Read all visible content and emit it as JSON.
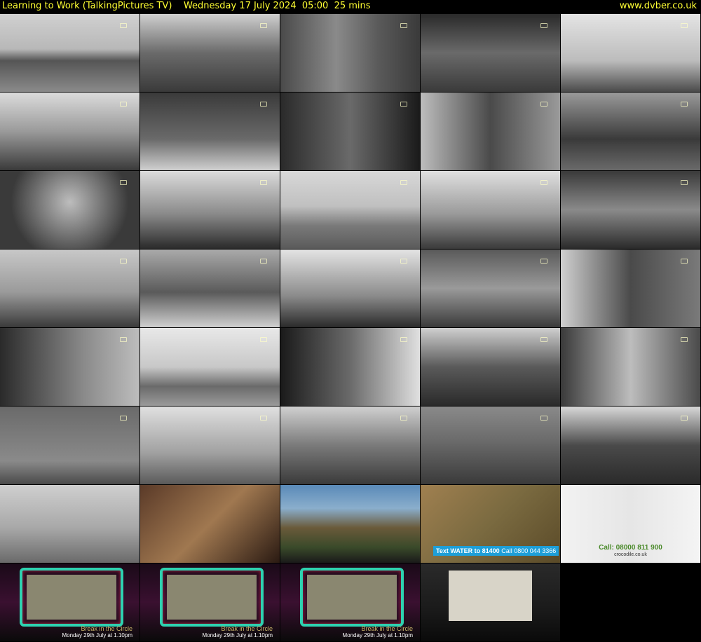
{
  "header": {
    "programme": "Learning to Work (TalkingPictures TV)",
    "datetime": "Wednesday 17 July 2024  05:00  25 mins",
    "website": "www.dvber.co.uk"
  },
  "colors": {
    "header_text": "#ffff33",
    "background": "#000000",
    "text_strip": "#1e9fd8",
    "crocodile_green": "#4a8a2a",
    "cinema_frame": "#2ed1b0"
  },
  "thumbnails": [
    {
      "id": 1,
      "scene": "thames-parliament",
      "bg": "linear-gradient(#d0d0d0 0%, #b8b8b8 45%, #555 60%, #8a8a8a 100%)"
    },
    {
      "id": 2,
      "scene": "city-street",
      "bg": "linear-gradient(#cfcfcf 0%, #6a6a6a 50%, #3a3a3a 100%)"
    },
    {
      "id": 3,
      "scene": "bank-entrance",
      "bg": "linear-gradient(90deg,#4a4a4a,#8a8a8a 40%,#5a5a5a 70%,#3a3a3a)"
    },
    {
      "id": 4,
      "scene": "uk-map",
      "bg": "linear-gradient(#2a2a2a,#6a6a6a 50%,#3a3a3a)"
    },
    {
      "id": 5,
      "scene": "tyne-bridge",
      "bg": "linear-gradient(#e4e4e4 0%,#bcbcbc 60%,#4a4a4a 100%)"
    },
    {
      "id": 6,
      "scene": "tram",
      "bg": "linear-gradient(#dcdcdc 0%,#9a9a9a 50%,#3a3a3a 100%)"
    },
    {
      "id": 7,
      "scene": "family-table",
      "bg": "linear-gradient(#3a3a3a,#6a6a6a 60%,#d0d0d0)"
    },
    {
      "id": 8,
      "scene": "women-pan",
      "bg": "linear-gradient(90deg,#2a2a2a,#6a6a6a 50%,#1a1a1a)"
    },
    {
      "id": 9,
      "scene": "woman-sink",
      "bg": "linear-gradient(90deg,#bdbdbd,#4a4a4a 50%,#9a9a9a)"
    },
    {
      "id": 10,
      "scene": "wheel-machinery",
      "bg": "linear-gradient(#9a9a9a,#3a3a3a 60%,#6a6a6a)"
    },
    {
      "id": 11,
      "scene": "steam-smoke",
      "bg": "radial-gradient(circle at 50% 40%,#bdbdbd,#3a3a3a 70%)"
    },
    {
      "id": 12,
      "scene": "factory-yard",
      "bg": "linear-gradient(#dcdcdc 0%,#8a8a8a 55%,#2a2a2a 100%)"
    },
    {
      "id": 13,
      "scene": "open-field",
      "bg": "linear-gradient(#d8d8d8 0%,#c0c0c0 45%,#7a7a7a 70%,#5a5a5a)"
    },
    {
      "id": 14,
      "scene": "factory-buildings",
      "bg": "linear-gradient(#e0e0e0 0%,#9a9a9a 55%,#3a3a3a 100%)"
    },
    {
      "id": 15,
      "scene": "workshop",
      "bg": "linear-gradient(#3a3a3a,#8a8a8a 50%,#2a2a2a)"
    },
    {
      "id": 16,
      "scene": "shipyard-skyline",
      "bg": "linear-gradient(#c8c8c8 0%,#9a9a9a 55%,#3a3a3a 100%)"
    },
    {
      "id": 17,
      "scene": "ship-hull-worker",
      "bg": "linear-gradient(#aaaaaa 0%,#5a5a5a 55%,#d0d0d0 100%)"
    },
    {
      "id": 18,
      "scene": "crane",
      "bg": "linear-gradient(#e4e4e4 0%,#8a8a8a 60%,#2a2a2a 100%)"
    },
    {
      "id": 19,
      "scene": "engineering-shop",
      "bg": "linear-gradient(#5a5a5a,#9a9a9a 50%,#3a3a3a)"
    },
    {
      "id": 20,
      "scene": "machinist",
      "bg": "linear-gradient(90deg,#d0d0d0,#4a4a4a 50%,#7a7a7a)"
    },
    {
      "id": 21,
      "scene": "riveter",
      "bg": "linear-gradient(90deg,#2a2a2a,#8a8a8a 60%,#bdbdbd)"
    },
    {
      "id": 22,
      "scene": "dockside",
      "bg": "linear-gradient(#e8e8e8 0%,#c8c8c8 50%,#6a6a6a 75%,#9a9a9a)"
    },
    {
      "id": 23,
      "scene": "woman-portrait",
      "bg": "linear-gradient(90deg,#1a1a1a,#6a6a6a 50%,#e0e0e0)"
    },
    {
      "id": 24,
      "scene": "bus",
      "bg": "linear-gradient(#cfcfcf 0%,#5a5a5a 50%,#2a2a2a 100%)"
    },
    {
      "id": 25,
      "scene": "street-tram",
      "bg": "linear-gradient(90deg,#3a3a3a,#bdbdbd 50%,#4a4a4a)"
    },
    {
      "id": 26,
      "scene": "brick-house",
      "bg": "linear-gradient(#6a6a6a,#8a8a8a 70%,#4a4a4a)"
    },
    {
      "id": 27,
      "scene": "radiogram",
      "bg": "linear-gradient(#e0e0e0 0%,#a0a0a0 60%,#5a5a5a 100%)"
    },
    {
      "id": 28,
      "scene": "football-crowd",
      "bg": "linear-gradient(#d0d0d0 0%,#7a7a7a 50%,#3a3a3a 100%)"
    },
    {
      "id": 29,
      "scene": "football-pitch",
      "bg": "linear-gradient(#8a8a8a 0%,#6a6a6a 45%,#3a3a3a 100%)"
    },
    {
      "id": 30,
      "scene": "ship-liverpool",
      "bg": "linear-gradient(#d8d8d8 0%,#4a4a4a 50%,#2a2a2a 100%)"
    },
    {
      "id": 31,
      "scene": "misty-harbour",
      "bg": "linear-gradient(#cfcfcf 0%,#a8a8a8 55%,#6a6a6a 100%)"
    },
    {
      "id": 32,
      "scene": "blurred-interior",
      "bg": "linear-gradient(135deg,#5a3a28,#a07850 50%,#2a1a12)"
    },
    {
      "id": 33,
      "scene": "mountain",
      "bg": "linear-gradient(#5a8ab8 0%,#8aaecc 30%,#6a5a3a 55%,#3a4a2a 80%,#1a1a1a 100%)"
    },
    {
      "id": 34,
      "scene": "water-aid",
      "bg": "linear-gradient(135deg,#a08050,#7a6a40 50%,#5a4a28)"
    },
    {
      "id": 35,
      "scene": "crocodile-ad",
      "bg": "linear-gradient(90deg,#f2f2f2,#e6e6e6 50%,#f4f4f4)"
    },
    {
      "id": 36,
      "scene": "cinema-1",
      "bg": "linear-gradient(#1a0a18,#3a1030 50%,#0a0a0a)"
    },
    {
      "id": 37,
      "scene": "cinema-2",
      "bg": "linear-gradient(#1a0a18,#3a1030 50%,#0a0a0a)"
    },
    {
      "id": 38,
      "scene": "cinema-3",
      "bg": "linear-gradient(#1a0a18,#3a1030 50%,#0a0a0a)"
    },
    {
      "id": 39,
      "scene": "cinema-credits",
      "bg": "linear-gradient(#2a2a2a,#1a1a1a 60%,#0a0a0a)"
    }
  ],
  "overlays": {
    "water_aid": {
      "strip_text_a": "Text WATER to 81400",
      "strip_text_b": "Call 0800 044 3366"
    },
    "crocodile": {
      "phone": "Call: 08000 811 900",
      "site": "crocodile.co.uk"
    },
    "cinema": {
      "promo_title": "Break in the Circle",
      "promo_date": "Monday 29th July at 1.10pm"
    }
  }
}
